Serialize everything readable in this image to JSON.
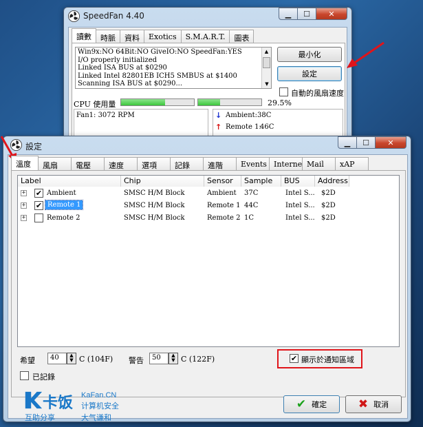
{
  "back_window": {
    "title": "SpeedFan 4.40",
    "tabs": [
      "讀數",
      "時脈",
      "資料",
      "Exotics",
      "S.M.A.R.T.",
      "圖表"
    ],
    "log_lines": [
      "Win9x:NO  64Bit:NO  GiveIO:NO  SpeedFan:YES",
      "I/O properly initialized",
      "Linked ISA BUS at $0290",
      "Linked Intel 82801EB ICH5 SMBUS at $1400",
      "Scanning ISA BUS at $0290..."
    ],
    "minimize_button": "最小化",
    "settings_button": "設定",
    "auto_fan_label": "自動的風扇速度",
    "cpu_usage_label": "CPU 使用量",
    "cpu_usage_percent": "29.5%",
    "cpu_bar1_fill": 0.6,
    "cpu_bar2_fill": 0.35,
    "fan_reading": "Fan1: 3072 RPM",
    "temps": [
      {
        "label": "Ambient:",
        "value": "38C"
      },
      {
        "label": "Remote 1:",
        "value": "46C"
      }
    ]
  },
  "settings_window": {
    "title": "設定",
    "tabs": [
      "溫度",
      "風扇",
      "電壓",
      "速度",
      "選項",
      "記錄",
      "進階",
      "Events",
      "Internet",
      "Mail",
      "xAP"
    ],
    "columns": [
      "Label",
      "Chip",
      "Sensor",
      "Sample",
      "BUS",
      "Address"
    ],
    "rows": [
      {
        "label": "Ambient",
        "chip": "SMSC H/M Block",
        "sensor": "Ambient",
        "sample": "37C",
        "bus": "Intel S...",
        "address": "$2D",
        "checked": true,
        "selected": false
      },
      {
        "label": "Remote 1",
        "chip": "SMSC H/M Block",
        "sensor": "Remote 1",
        "sample": "44C",
        "bus": "Intel S...",
        "address": "$2D",
        "checked": true,
        "selected": true
      },
      {
        "label": "Remote 2",
        "chip": "SMSC H/M Block",
        "sensor": "Remote 2",
        "sample": "1C",
        "bus": "Intel S...",
        "address": "$2D",
        "checked": false,
        "selected": false
      }
    ],
    "desired_label": "希望",
    "desired_value": "40",
    "desired_unit": "C (104F)",
    "warning_label": "警告",
    "warning_value": "50",
    "warning_unit": "C (122F)",
    "show_in_tray_label": "顯示於通知區域",
    "log_label": "已記錄",
    "ok_button": "確定",
    "cancel_button": "取消",
    "check_mark": "✔",
    "expand_mark": "+"
  },
  "watermark": {
    "brand_cn": "卡饭",
    "brand_en": "KaFan.CN",
    "subtitle_cn": "计算机安全",
    "slogan_left": "互助分享",
    "slogan_right": "大气谦和"
  },
  "colors": {
    "selection": "#3399ff",
    "progress_green": "#3cc63c",
    "highlight_red": "#e0141a",
    "ok_check": "#1aa11a",
    "cancel_x": "#d01818",
    "temp_down_arrow": "#1a2fcf",
    "temp_up_arrow": "#d81414"
  }
}
